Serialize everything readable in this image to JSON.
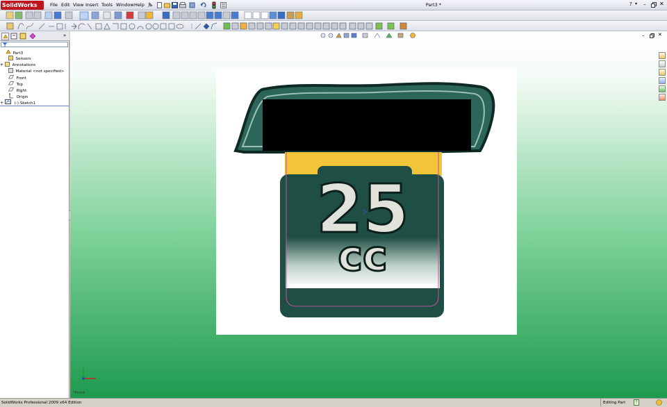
{
  "app": {
    "logo_text": "SolidWorks",
    "document_title": "Part3 *",
    "help_icon": "question-icon",
    "window_controls": [
      "minimize-icon",
      "restore-icon",
      "close-icon"
    ]
  },
  "menu": {
    "items": [
      "File",
      "Edit",
      "View",
      "Insert",
      "Tools",
      "Window",
      "Help"
    ]
  },
  "feature_tree": {
    "filter_placeholder": "",
    "items": [
      {
        "label": "Part3",
        "icon": "part-icon",
        "expander": ""
      },
      {
        "label": "Sensors",
        "icon": "sensor-icon",
        "expander": ""
      },
      {
        "label": "Annotations",
        "icon": "annotation-icon",
        "expander": "+"
      },
      {
        "label": "Material <not specified>",
        "icon": "material-icon",
        "expander": ""
      },
      {
        "label": "Front",
        "icon": "plane-icon",
        "expander": ""
      },
      {
        "label": "Top",
        "icon": "plane-icon",
        "expander": ""
      },
      {
        "label": "Right",
        "icon": "plane-icon",
        "expander": ""
      },
      {
        "label": "Origin",
        "icon": "origin-icon",
        "expander": ""
      },
      {
        "label": "(-) Sketch1",
        "icon": "sketch-icon",
        "expander": "+"
      }
    ]
  },
  "graphic": {
    "number_text": "25",
    "unit_text": "cc",
    "view_label": "*Front"
  },
  "status": {
    "left": "SolidWorks Professional 2009 x64 Edition",
    "mode": "Editing Part",
    "help_badge": "?"
  },
  "colors": {
    "brand_red": "#c0141d",
    "viewport_green": "#1d9a4e",
    "decal_teal": "#1f4f44",
    "decal_yellow": "#f2c43a",
    "sketch_line": "#c0509a"
  }
}
